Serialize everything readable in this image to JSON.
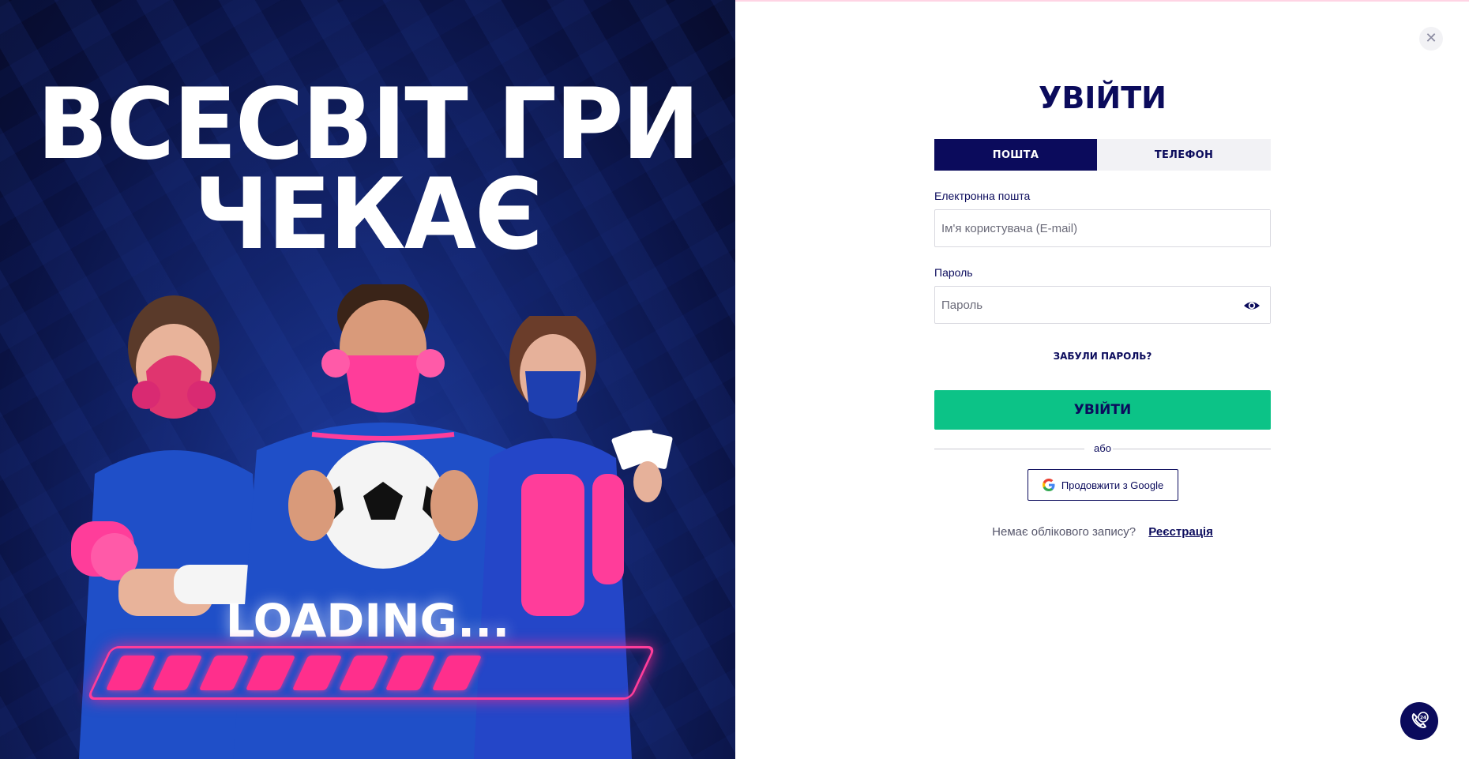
{
  "promo": {
    "title_line1": "ВСЕСВІТ ГРИ",
    "title_line2": "ЧЕКАЄ",
    "loading_text": "LOADING...",
    "loading_segments": 8,
    "colors": {
      "background": "#0a1242",
      "accent": "#ff2f8c"
    }
  },
  "login": {
    "title": "УВІЙТИ",
    "tabs": [
      {
        "label": "ПОШТА",
        "active": true
      },
      {
        "label": "ТЕЛЕФОН",
        "active": false
      }
    ],
    "email": {
      "label": "Електронна пошта",
      "placeholder": "Ім'я користувача (E-mail)",
      "value": ""
    },
    "password": {
      "label": "Пароль",
      "placeholder": "Пароль",
      "value": "",
      "toggle_icon": "eye-icon"
    },
    "forgot_label": "ЗАБУЛИ ПАРОЛЬ?",
    "submit_label": "УВІЙТИ",
    "divider_label": "або",
    "google_label": "Продовжити з Google",
    "signup_question": "Немає облікового запису?",
    "signup_link": "Реєстрація",
    "close_icon": "close-icon",
    "support_icon": "support-24-icon",
    "colors": {
      "primary": "#0b0b5c",
      "submit": "#0cc387"
    }
  }
}
